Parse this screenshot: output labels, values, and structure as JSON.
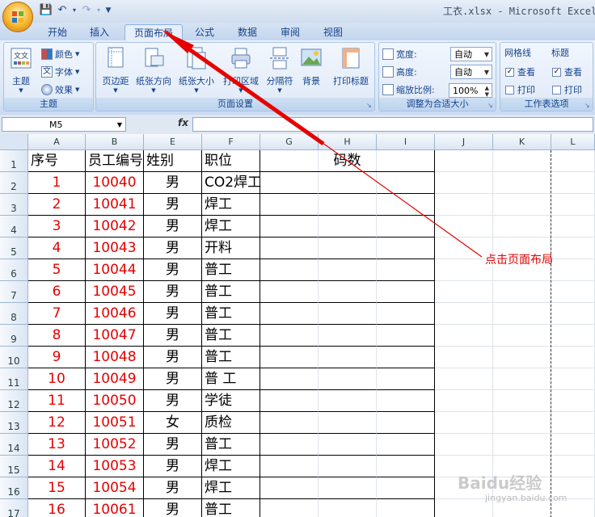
{
  "window": {
    "title": "工衣.xlsx - Microsoft Excel"
  },
  "ribbon_tabs": [
    {
      "label": "开始"
    },
    {
      "label": "插入"
    },
    {
      "label": "页面布局",
      "active": true
    },
    {
      "label": "公式"
    },
    {
      "label": "数据"
    },
    {
      "label": "审阅"
    },
    {
      "label": "视图"
    }
  ],
  "groups": {
    "theme": {
      "label": "主题",
      "big_button": "主题",
      "colors": "颜色",
      "fonts": "字体",
      "effects": "效果"
    },
    "page_setup": {
      "label": "页面设置",
      "buttons": [
        "页边距",
        "纸张方向",
        "纸张大小",
        "打印区域",
        "分隔符",
        "背景",
        "打印标题"
      ]
    },
    "scale": {
      "label": "调整为合适大小",
      "width_label": "宽度:",
      "width_value": "自动",
      "height_label": "高度:",
      "height_value": "自动",
      "scale_label": "缩放比例:",
      "scale_value": "100%"
    },
    "sheet_options": {
      "label": "工作表选项",
      "gridlines": "网格线",
      "headings": "标题",
      "view": "查看",
      "print": "打印",
      "gridlines_view_checked": true,
      "headings_view_checked": true
    }
  },
  "formula_bar": {
    "name_box": "M5",
    "fx": "fx"
  },
  "sheet": {
    "column_headers": [
      "A",
      "B",
      "E",
      "F",
      "G",
      "H",
      "I",
      "J",
      "K",
      "L"
    ],
    "row_numbers": [
      "1",
      "2",
      "3",
      "4",
      "5",
      "6",
      "7",
      "8",
      "9",
      "10",
      "11",
      "12",
      "13",
      "14",
      "15",
      "16",
      "17"
    ],
    "header_row": [
      "序号",
      "员工编号",
      "姓别",
      "职位",
      "",
      "码数"
    ],
    "rows": [
      [
        "1",
        "10040",
        "男",
        "CO2焊工"
      ],
      [
        "2",
        "10041",
        "男",
        "焊工"
      ],
      [
        "3",
        "10042",
        "男",
        "焊工"
      ],
      [
        "4",
        "10043",
        "男",
        "开料"
      ],
      [
        "5",
        "10044",
        "男",
        "普工"
      ],
      [
        "6",
        "10045",
        "男",
        "普工"
      ],
      [
        "7",
        "10046",
        "男",
        "普工"
      ],
      [
        "8",
        "10047",
        "男",
        "普工"
      ],
      [
        "9",
        "10048",
        "男",
        "普工"
      ],
      [
        "10",
        "10049",
        "男",
        "普  工"
      ],
      [
        "11",
        "10050",
        "男",
        "学徒"
      ],
      [
        "12",
        "10051",
        "女",
        "质检"
      ],
      [
        "13",
        "10052",
        "男",
        "普工"
      ],
      [
        "14",
        "10053",
        "男",
        "焊工"
      ],
      [
        "15",
        "10054",
        "男",
        "焊工"
      ],
      [
        "16",
        "10061",
        "男",
        "普工"
      ]
    ]
  },
  "annotation": {
    "text": "点击页面布局",
    "color": "#e60000"
  },
  "watermark": {
    "brand": "Baidu经验",
    "url": "jingyan.baidu.com"
  }
}
